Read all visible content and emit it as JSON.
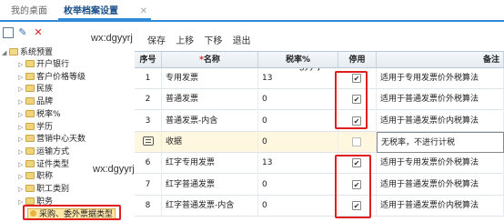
{
  "tabs": [
    {
      "label": "我的桌面",
      "active": false
    },
    {
      "label": "枚举档案设置",
      "active": true,
      "close": "✕"
    }
  ],
  "tree": {
    "toolbar_icons": [
      "new-document-icon",
      "edit-icon",
      "delete-icon"
    ],
    "root": "系统预置",
    "items": [
      "开户银行",
      "客户价格等级",
      "民族",
      "品牌",
      "税率%",
      "学历",
      "营销中心天数",
      "运输方式",
      "证件类型",
      "职称",
      "职工类别",
      "职务",
      "采购、委外票据类型"
    ],
    "selected_index": 12
  },
  "watermark": "wx:dgyyrj",
  "toolbar": {
    "save": "保存",
    "up": "上移",
    "down": "下移",
    "exit": "退出"
  },
  "grid": {
    "headers": {
      "no": "序号",
      "name": "名称",
      "required_mark": "*",
      "tax": "税率%",
      "disabled": "停用",
      "remark": "备注"
    },
    "rows": [
      {
        "no": "1",
        "name": "专用发票",
        "tax": "13",
        "checked": true,
        "remark": "适用于专用发票价外税算法"
      },
      {
        "no": "2",
        "name": "普通发票",
        "tax": "0",
        "checked": true,
        "remark": "适用于普通发票价外税算法"
      },
      {
        "no": "3",
        "name": "普通发票-内含",
        "tax": "0",
        "checked": true,
        "remark": "适用于普通发票价内税算法"
      },
      {
        "no": "",
        "name": "收据",
        "tax": "0",
        "checked": false,
        "remark": "无税率，不进行计税",
        "drag": true
      },
      {
        "no": "6",
        "name": "红字专用发票",
        "tax": "13",
        "checked": true,
        "remark": "适用于专用发票价外税算法"
      },
      {
        "no": "7",
        "name": "红字普通发票",
        "tax": "0",
        "checked": true,
        "remark": "适用于普通发票价外税算法"
      },
      {
        "no": "8",
        "name": "红字普通发票-内含",
        "tax": "0",
        "checked": true,
        "remark": "适用于普通发票价内税算法"
      }
    ]
  },
  "colors": {
    "accent": "#2f8ad8",
    "highlight_border": "#e02020",
    "selected_row": "#fff7e0"
  }
}
